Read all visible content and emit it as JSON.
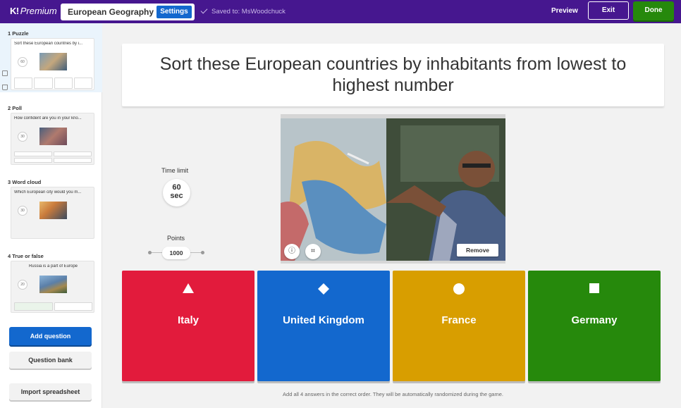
{
  "header": {
    "logo_mark": "K!",
    "logo_text": "Premium",
    "title": "European Geography",
    "settings_label": "Settings",
    "saved_text": "Saved to: MsWoodchuck",
    "preview_label": "Preview",
    "exit_label": "Exit",
    "done_label": "Done",
    "colors": {
      "bar": "#46178f",
      "done": "#26890c",
      "settings": "#1368ce"
    }
  },
  "sidebar": {
    "slides": [
      {
        "label": "1  Puzzle",
        "question": "Sort these European countries by i...",
        "timer": "60"
      },
      {
        "label": "2  Poll",
        "question": "How confident are you in your kno...",
        "timer": "30"
      },
      {
        "label": "3  Word cloud",
        "question": "Which European city would you m...",
        "timer": "30"
      },
      {
        "label": "4  True or false",
        "question": "Russia is a part of Europe",
        "timer": "20"
      }
    ],
    "add_question_label": "Add question",
    "question_bank_label": "Question bank",
    "import_label": "Import spreadsheet",
    "side_icons": [
      "duplicate-icon",
      "delete-icon"
    ]
  },
  "question": {
    "text": "Sort these European countries by inhabitants from lowest to highest number"
  },
  "settings_panel": {
    "time_label": "Time limit",
    "time_value": "60",
    "time_unit": "sec",
    "points_label": "Points",
    "points_value": "1000"
  },
  "media": {
    "remove_label": "Remove",
    "icons": [
      "info-icon",
      "crop-icon"
    ]
  },
  "answers": [
    {
      "label": "Italy",
      "shape": "triangle",
      "color": "#e21b3c"
    },
    {
      "label": "United Kingdom",
      "shape": "diamond",
      "color": "#1368ce"
    },
    {
      "label": "France",
      "shape": "circle",
      "color": "#d89e00"
    },
    {
      "label": "Germany",
      "shape": "square",
      "color": "#26890c"
    }
  ],
  "hint": "Add all 4 answers in the correct order. They will be automatically randomized during the game."
}
